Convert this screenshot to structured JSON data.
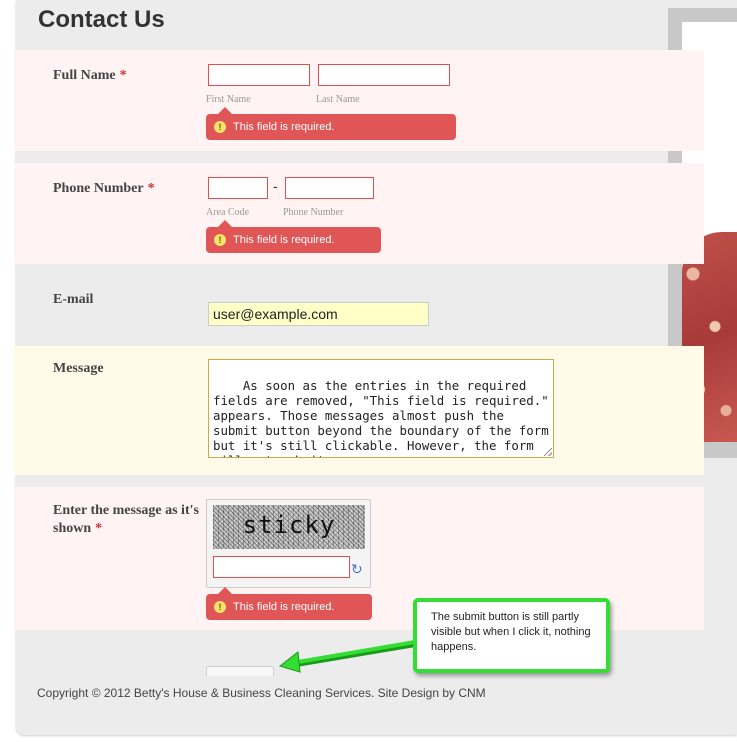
{
  "page_title": "Contact Us",
  "required_marker": "*",
  "error_tip_text": "This field is required.",
  "warning_glyph": "!",
  "full_name": {
    "label": "Full Name",
    "first_value": "",
    "last_value": "",
    "first_sublabel": "First Name",
    "last_sublabel": "Last Name"
  },
  "phone": {
    "label": "Phone Number",
    "area_value": "",
    "number_value": "",
    "separator": "-",
    "area_sublabel": "Area Code",
    "number_sublabel": "Phone Number"
  },
  "email": {
    "label": "E-mail",
    "value": "user@example.com"
  },
  "message": {
    "label": "Message",
    "value": "As soon as the entries in the required fields are removed, \"This field is required.\" appears. Those messages almost push the submit button beyond the boundary of the form but it's still clickable. However, the form will not submit."
  },
  "captcha": {
    "label": "Enter the message as it's shown",
    "image_text": "sticky",
    "input_value": "",
    "refresh_icon": "refresh-icon"
  },
  "callout": {
    "text": "The submit button is still partly visible but when I click it, nothing happens."
  },
  "footer": {
    "text": "Copyright © 2012 Betty's House & Business Cleaning Services. Site Design by CNM"
  },
  "colors": {
    "error_bg": "#fff3f3",
    "error_tip": "#e05555",
    "message_bg": "#fffbe8",
    "email_bg": "#ffffc8",
    "callout_border": "#33dd33"
  }
}
